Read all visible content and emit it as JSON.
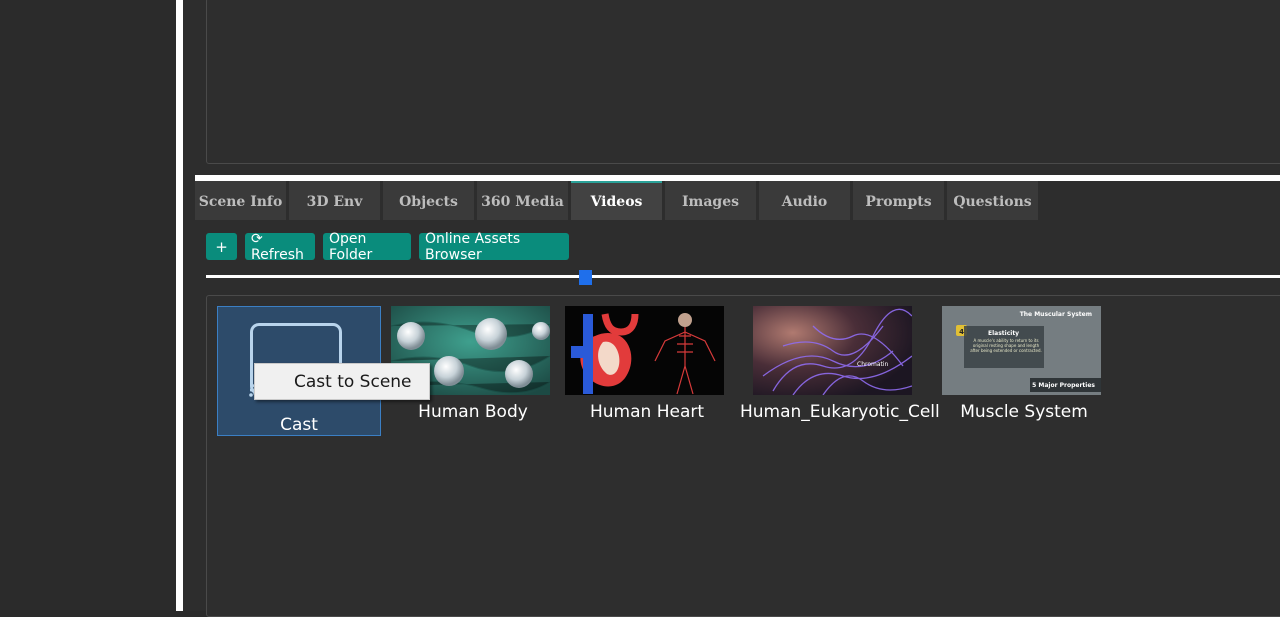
{
  "tabs": [
    {
      "label": "Scene Info"
    },
    {
      "label": "3D Env"
    },
    {
      "label": "Objects"
    },
    {
      "label": "360 Media"
    },
    {
      "label": "Videos",
      "active": true
    },
    {
      "label": "Images"
    },
    {
      "label": "Audio"
    },
    {
      "label": "Prompts"
    },
    {
      "label": "Questions"
    }
  ],
  "toolbar": {
    "add_label": "+",
    "refresh_label": "⟳ Refresh",
    "open_folder_label": "Open Folder",
    "online_assets_label": "Online Assets Browser"
  },
  "assets": [
    {
      "label": "Cast",
      "selected": true
    },
    {
      "label": "Human Body"
    },
    {
      "label": "Human Heart"
    },
    {
      "label": "Human_Eukaryotic_Cell"
    },
    {
      "label": "Muscle System"
    }
  ],
  "thumb_text": {
    "muscle_title": "The Muscular System",
    "muscle_badge": "4",
    "muscle_heading": "Elasticity",
    "muscle_body": "A muscle's ability to return to its original resting shape and length after being extended or contracted.",
    "muscle_footer": "5 Major Properties",
    "cell_label": "Chromatin"
  },
  "context_menu": {
    "item_label": "Cast to Scene"
  },
  "colors": {
    "accent": "#0a8c7c",
    "selected_bg": "#2d4b6a",
    "slider_thumb": "#1f6feb"
  }
}
